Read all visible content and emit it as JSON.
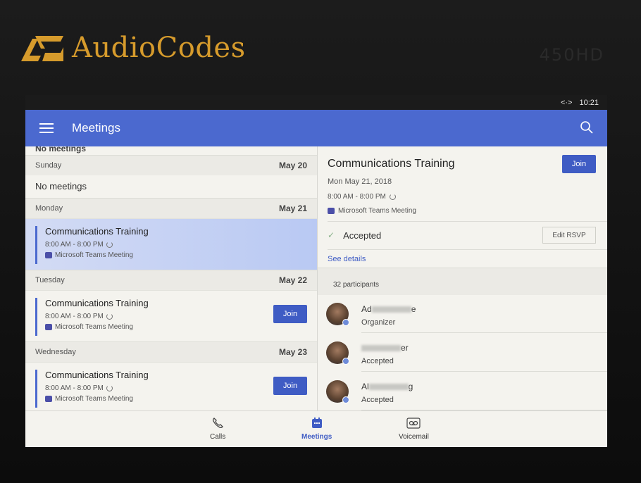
{
  "device": {
    "brand": "AudioCodes",
    "model": "450HD"
  },
  "status_bar": {
    "connection_icon": "<·>",
    "time": "10:21"
  },
  "app_bar": {
    "title": "Meetings"
  },
  "agenda": {
    "cutoff_text": "No meetings",
    "days": [
      {
        "label": "Sunday",
        "date": "May 20",
        "empty_text": "No meetings"
      },
      {
        "label": "Monday",
        "date": "May 21",
        "meeting": {
          "title": "Communications Training",
          "time": "8:00 AM - 8:00 PM",
          "type": "Microsoft Teams Meeting"
        }
      },
      {
        "label": "Tuesday",
        "date": "May 22",
        "meeting": {
          "title": "Communications Training",
          "time": "8:00 AM - 8:00 PM",
          "type": "Microsoft Teams Meeting",
          "join_label": "Join"
        }
      },
      {
        "label": "Wednesday",
        "date": "May 23",
        "meeting": {
          "title": "Communications Training",
          "time": "8:00 AM - 8:00 PM",
          "type": "Microsoft Teams Meeting",
          "join_label": "Join"
        }
      }
    ]
  },
  "details": {
    "title": "Communications Training",
    "join_label": "Join",
    "date": "Mon May 21, 2018",
    "time": "8:00 AM - 8:00 PM",
    "type": "Microsoft Teams Meeting",
    "rsvp_status": "Accepted",
    "edit_rsvp_label": "Edit RSVP",
    "see_details_label": "See details",
    "participants_count": "32 participants",
    "participants": [
      {
        "name_start": "Ad",
        "name_end": "e",
        "role": "Organizer"
      },
      {
        "name_start": "",
        "name_end": "er",
        "role": "Accepted"
      },
      {
        "name_start": "Al",
        "name_end": "g",
        "role": "Accepted"
      }
    ]
  },
  "bottom_nav": {
    "calls": "Calls",
    "meetings": "Meetings",
    "voicemail": "Voicemail"
  },
  "colors": {
    "accent": "#4b69cf",
    "brand": "#d69b2c"
  }
}
